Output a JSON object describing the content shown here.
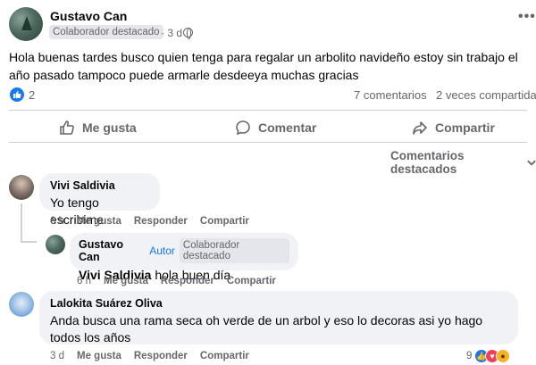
{
  "post": {
    "author": "Gustavo Can",
    "badge": "Colaborador destacado",
    "time": "· 3 d ·",
    "more": "•••",
    "text": "Hola buenas tardes busco quien tenga para regalar un arbolito navideño estoy sin trabajo el año pasado tampoco puede armarle desdeeya muchas gracias",
    "reactions_count": "2",
    "comments_count": "7 comentarios",
    "shares_count": "2 veces compartida"
  },
  "actions": {
    "like": "Me gusta",
    "comment": "Comentar",
    "share": "Compartir"
  },
  "sort_label": "Comentarios destacados",
  "comments": [
    {
      "name": "Vivi Saldivia",
      "text": "Yo tengo escribime",
      "time": "6 h",
      "like": "Me gusta",
      "reply": "Responder",
      "share": "Compartir",
      "reply_item": {
        "name": "Gustavo Can",
        "author_tag": "Autor",
        "badge": "Colaborador destacado",
        "mention": "Vivi Saldivia",
        "text": "hola buen día",
        "time": "6 h",
        "like": "Me gusta",
        "reply": "Responder",
        "share": "Compartir"
      }
    },
    {
      "name": "Lalokita Suárez Oliva",
      "text": "Anda busca una rama seca oh verde de un arbol y eso lo decoras asi yo hago todos los años",
      "time": "3 d",
      "like": "Me gusta",
      "reply": "Responder",
      "share": "Compartir",
      "reaction_count": "9"
    }
  ],
  "colors": {
    "accent": "#1877f2",
    "bubble": "#f0f2f5",
    "secondary_text": "#65676b"
  }
}
